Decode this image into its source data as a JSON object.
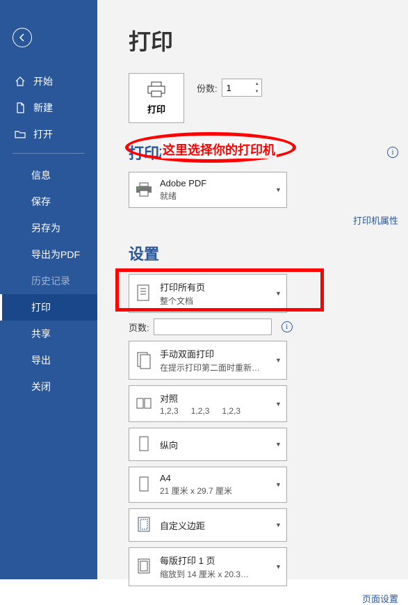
{
  "sidebar": {
    "primary": [
      {
        "label": "开始",
        "icon": "home"
      },
      {
        "label": "新建",
        "icon": "new"
      },
      {
        "label": "打开",
        "icon": "open"
      }
    ],
    "secondary": [
      {
        "label": "信息",
        "active": false
      },
      {
        "label": "保存",
        "active": false
      },
      {
        "label": "另存为",
        "active": false
      },
      {
        "label": "导出为PDF",
        "active": false
      },
      {
        "label": "历史记录",
        "active": false,
        "disabled": true
      },
      {
        "label": "打印",
        "active": true
      },
      {
        "label": "共享",
        "active": false
      },
      {
        "label": "导出",
        "active": false
      },
      {
        "label": "关闭",
        "active": false
      }
    ]
  },
  "page": {
    "title": "打印",
    "print_button": "打印",
    "copies_label": "份数:",
    "copies_value": "1"
  },
  "printer": {
    "heading": "打印机",
    "name": "Adobe PDF",
    "status": "就绪",
    "annotation": "这里选择你的打印机",
    "properties_link": "打印机属性"
  },
  "settings": {
    "heading": "设置",
    "print_range": {
      "line1": "打印所有页",
      "line2": "整个文档"
    },
    "pages_label": "页数:",
    "pages_value": "",
    "duplex": {
      "line1": "手动双面打印",
      "line2": "在提示打印第二面时重新…"
    },
    "collate": {
      "line1": "对照",
      "n1": "1,2,3",
      "n2": "1,2,3",
      "n3": "1,2,3"
    },
    "orientation": {
      "line1": "纵向"
    },
    "paper": {
      "line1": "A4",
      "line2": "21 厘米 x 29.7 厘米"
    },
    "margins": {
      "line1": "自定义边距"
    },
    "sheets": {
      "line1": "每版打印 1 页",
      "line2": "缩放到 14 厘米 x 20.3…"
    },
    "page_setup_link": "页面设置"
  }
}
